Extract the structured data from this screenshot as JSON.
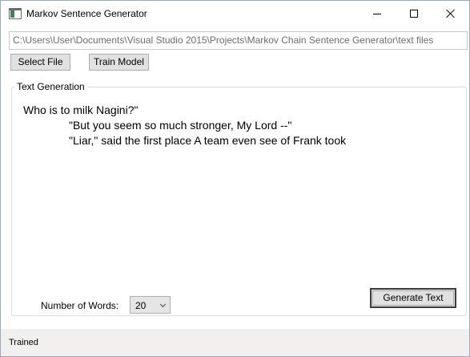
{
  "window": {
    "title": "Markov Sentence Generator"
  },
  "file": {
    "path": "C:\\Users\\User\\Documents\\Visual Studio 2015\\Projects\\Markov Chain Sentence Generator\\text files"
  },
  "toolbar": {
    "select_file_label": "Select File",
    "train_model_label": "Train Model"
  },
  "text_generation": {
    "group_label": "Text Generation",
    "lines": [
      "Who is to milk Nagini?\"",
      "\"But you seem so much stronger, My Lord --\"",
      "\"Liar,\" said the first place A team even see of Frank took"
    ],
    "number_of_words_label": "Number of Words:",
    "number_of_words_value": "20",
    "generate_label": "Generate Text"
  },
  "status": {
    "text": "Trained"
  }
}
